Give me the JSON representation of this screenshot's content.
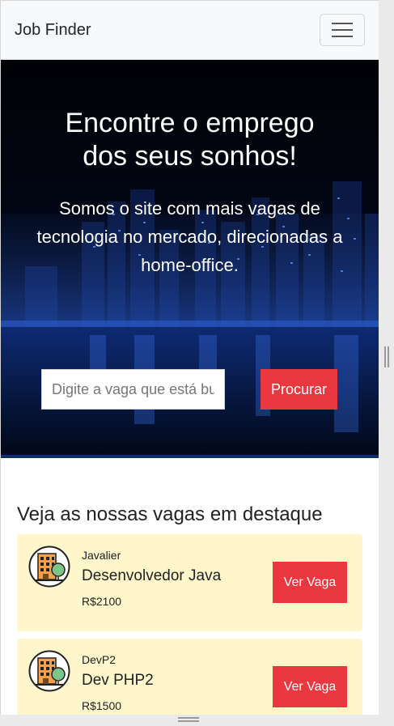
{
  "navbar": {
    "brand": "Job Finder",
    "menu_icon": "hamburger-menu-icon"
  },
  "hero": {
    "title": "Encontre o emprego dos seus sonhos!",
    "subtitle": "Somos o site com mais vagas de tecnologia no mercado, direcionadas a home-office.",
    "background": "night-city-skyline-image",
    "search_placeholder": "Digite a vaga que está buscando",
    "search_button": "Procurar"
  },
  "featured": {
    "heading": "Veja as nossas vagas em destaque",
    "jobs": [
      {
        "company": "Javalier",
        "title": "Desenvolvedor Java",
        "salary": "R$2100",
        "button": "Ver Vaga",
        "icon": "company-building-icon"
      },
      {
        "company": "DevP2",
        "title": "Dev PHP2",
        "salary": "R$1500",
        "button": "Ver Vaga",
        "icon": "company-building-icon"
      }
    ]
  },
  "colors": {
    "accent": "#e9383f",
    "card_background": "#fff6cc",
    "navbar_background": "#f8f9fa"
  }
}
